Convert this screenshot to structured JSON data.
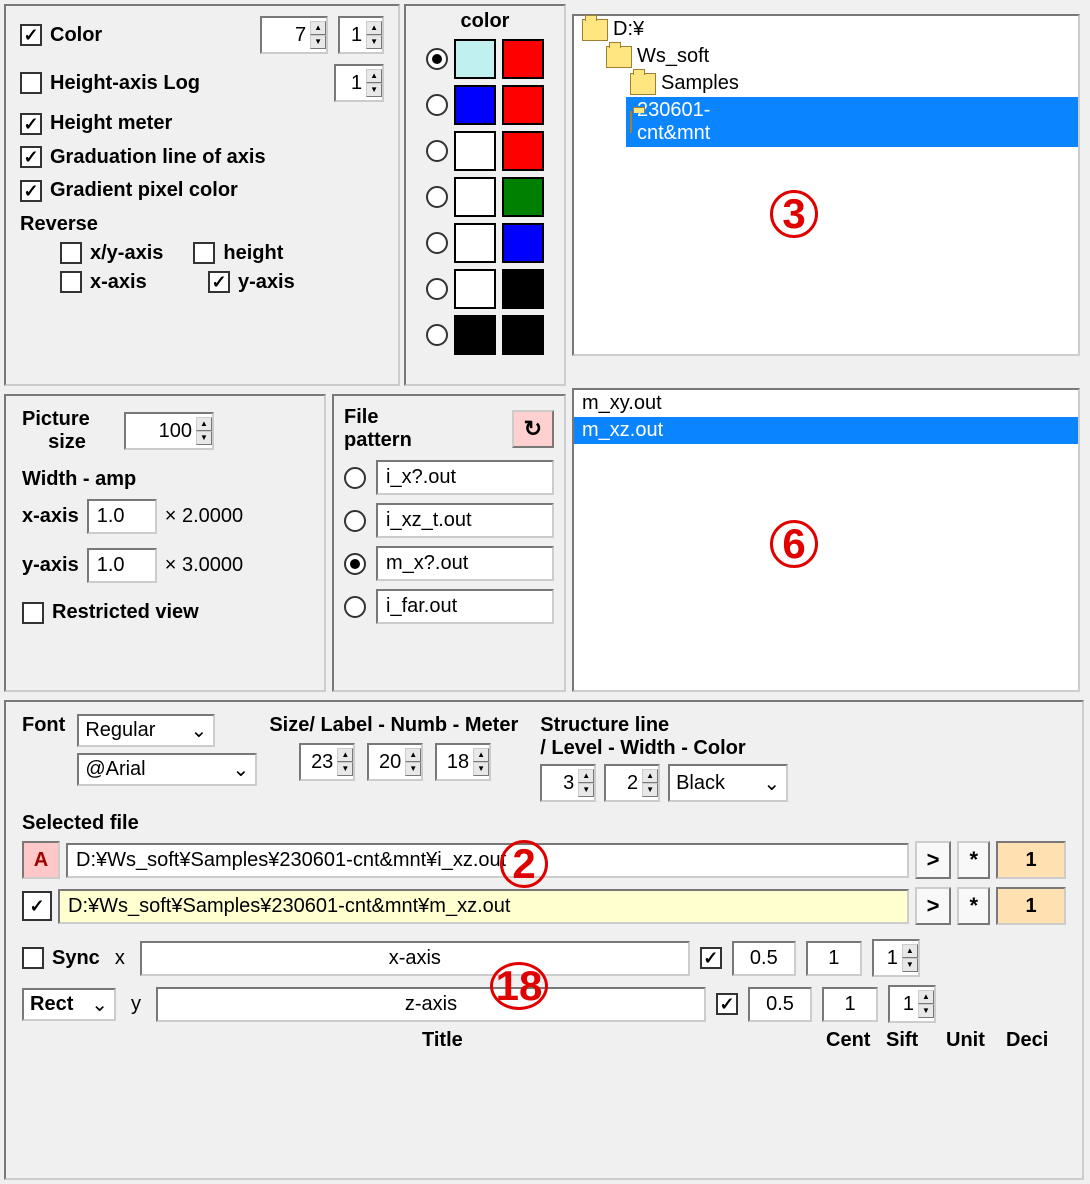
{
  "options": {
    "color_label": "Color",
    "color_val1": "7",
    "color_val2": "1",
    "height_log_label": "Height-axis Log",
    "height_log_val": "1",
    "height_meter_label": "Height meter",
    "grad_line_label": "Graduation line of axis",
    "grad_pixel_label": "Gradient pixel color",
    "reverse_label": "Reverse",
    "xy_axis_label": "x/y-axis",
    "x_axis_label": "x-axis",
    "height_label": "height",
    "y_axis_label": "y-axis"
  },
  "color_header": "color",
  "colors": [
    {
      "a": "#c0f0f0",
      "b": "#ff0000"
    },
    {
      "a": "#0000ff",
      "b": "#ff0000"
    },
    {
      "a": "#ffffff",
      "b": "#ff0000"
    },
    {
      "a": "#ffffff",
      "b": "#008000"
    },
    {
      "a": "#ffffff",
      "b": "#0000ff"
    },
    {
      "a": "#ffffff",
      "b": "#000000"
    },
    {
      "a": "#000000",
      "b": "#000000"
    }
  ],
  "tree": {
    "items": [
      "D:¥",
      "Ws_soft",
      "Samples",
      "230601-cnt&mnt"
    ]
  },
  "picture": {
    "size_label": "Picture size",
    "size_val": "100",
    "width_amp_label": "Width - amp",
    "x_label": "x-axis",
    "x_val": "1.0",
    "x_mult": "× 2.0000",
    "y_label": "y-axis",
    "y_val": "1.0",
    "y_mult": "× 3.0000",
    "restricted_label": "Restricted view"
  },
  "file_pattern": {
    "label": "File pattern",
    "refresh": "↻",
    "items": [
      "i_x?.out",
      "i_xz_t.out",
      "m_x?.out",
      "i_far.out"
    ]
  },
  "file_list": [
    "m_xy.out",
    "m_xz.out"
  ],
  "font": {
    "label": "Font",
    "style": "Regular",
    "family": "@Arial",
    "size_label": "Size/ Label - Numb - Meter",
    "s1": "23",
    "s2": "20",
    "s3": "18"
  },
  "structure": {
    "label": "Structure line",
    "sub_label": "/ Level - Width - Color",
    "level": "3",
    "width": "2",
    "color": "Black"
  },
  "selected": {
    "label": "Selected file",
    "a_badge": "A",
    "file1": "D:¥Ws_soft¥Samples¥230601-cnt&mnt¥i_xz.out",
    "file2": "D:¥Ws_soft¥Samples¥230601-cnt&mnt¥m_xz.out",
    "gt": ">",
    "star": "*",
    "num": "1"
  },
  "sync": {
    "sync_label": "Sync",
    "rect_label": "Rect",
    "x": "x",
    "y": "y",
    "x_title": "x-axis",
    "y_title": "z-axis",
    "cent_x": "0.5",
    "cent_y": "0.5",
    "unit_x": "1",
    "unit_y": "1",
    "deci_x": "1",
    "deci_y": "1",
    "title_hdr": "Title",
    "cent_hdr": "Cent",
    "sift_hdr": "Sift",
    "unit_hdr": "Unit",
    "deci_hdr": "Deci"
  },
  "annotations": {
    "a1": "3",
    "a2": "6",
    "a3": "2",
    "a4": "18"
  }
}
